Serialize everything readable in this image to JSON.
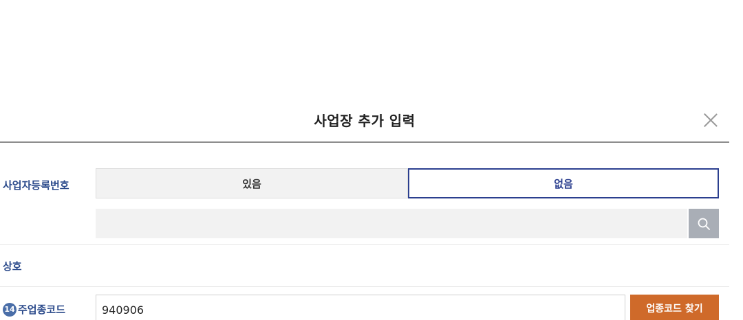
{
  "modal": {
    "title": "사업장 추가 입력"
  },
  "business_registration": {
    "label": "사업자등록번호",
    "option_yes": "있음",
    "option_no": "없음",
    "selected": "없음",
    "input_value": "",
    "input_placeholder": ""
  },
  "business_name": {
    "label": "상호"
  },
  "industry_code": {
    "badge_number": "14",
    "label": "주업종코드",
    "input_value": "940906",
    "find_button_label": "업종코드 찾기"
  },
  "colors": {
    "accent_blue": "#2b3f8f",
    "label_blue": "#2b4a8b",
    "find_button": "#cf6a2a",
    "search_button": "#a9aeb6"
  },
  "icons": {
    "close": "close-icon",
    "search": "search-icon"
  }
}
